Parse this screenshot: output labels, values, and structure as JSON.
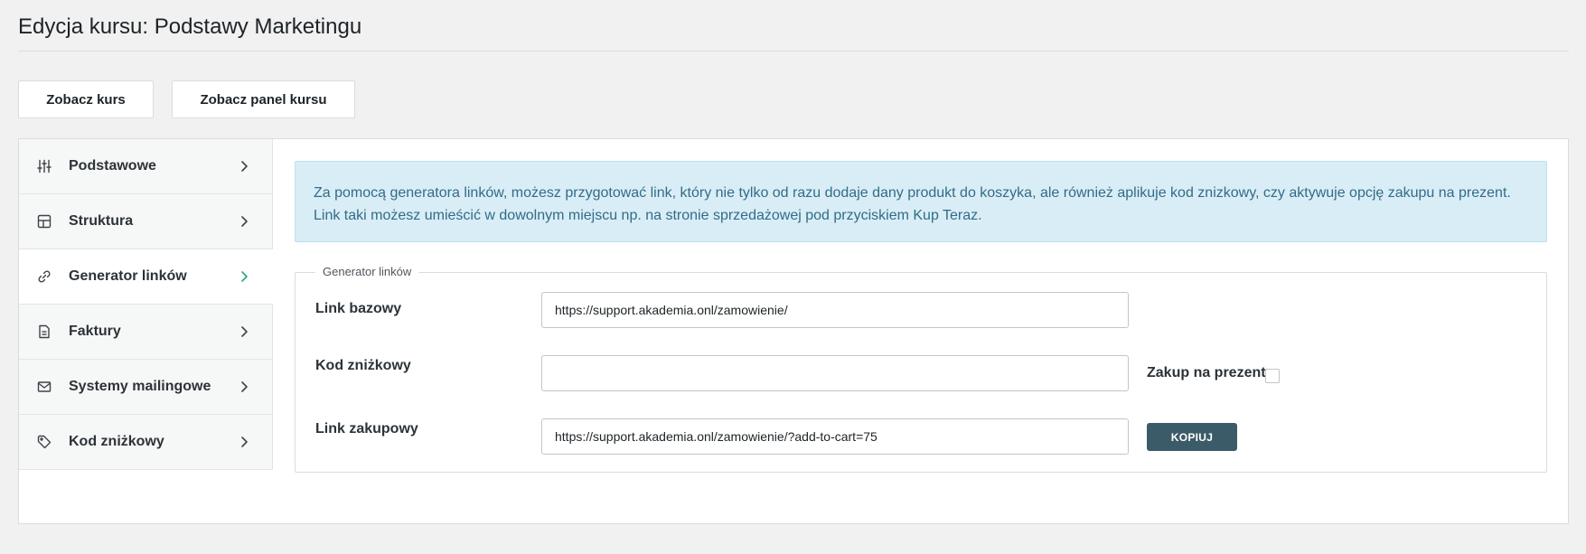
{
  "header": {
    "title": "Edycja kursu: Podstawy Marketingu"
  },
  "toolbar": {
    "view_course_label": "Zobacz kurs",
    "view_panel_label": "Zobacz panel kursu"
  },
  "sidebar": {
    "items": [
      {
        "label": "Podstawowe",
        "icon": "sliders-icon",
        "active": false
      },
      {
        "label": "Struktura",
        "icon": "grid-icon",
        "active": false
      },
      {
        "label": "Generator linków",
        "icon": "link-icon",
        "active": true
      },
      {
        "label": "Faktury",
        "icon": "document-icon",
        "active": false
      },
      {
        "label": "Systemy mailingowe",
        "icon": "envelope-icon",
        "active": false
      },
      {
        "label": "Kod zniżkowy",
        "icon": "tag-icon",
        "active": false
      }
    ]
  },
  "notice": {
    "line1": "Za pomocą generatora linków, możesz przygotować link, który nie tylko od razu dodaje dany produkt do koszyka, ale również aplikuje kod znizkowy, czy aktywuje opcję zakupu na prezent.",
    "line2": "Link taki możesz umieścić w dowolnym miejscu np. na stronie sprzedażowej pod przyciskiem Kup Teraz."
  },
  "generator": {
    "legend": "Generator linków",
    "base_link_label": "Link bazowy",
    "base_link_value": "https://support.akademia.onl/zamowienie/",
    "discount_label": "Kod zniżkowy",
    "discount_value": "",
    "gift_label": "Zakup na prezent",
    "gift_checked": false,
    "purchase_link_label": "Link zakupowy",
    "purchase_link_value": "https://support.akademia.onl/zamowienie/?add-to-cart=75",
    "copy_label": "KOPIUJ"
  },
  "colors": {
    "accent_active": "#2aa875",
    "notice_bg": "#d9edf6",
    "notice_text": "#316c87",
    "copy_button": "#3c5b68"
  }
}
